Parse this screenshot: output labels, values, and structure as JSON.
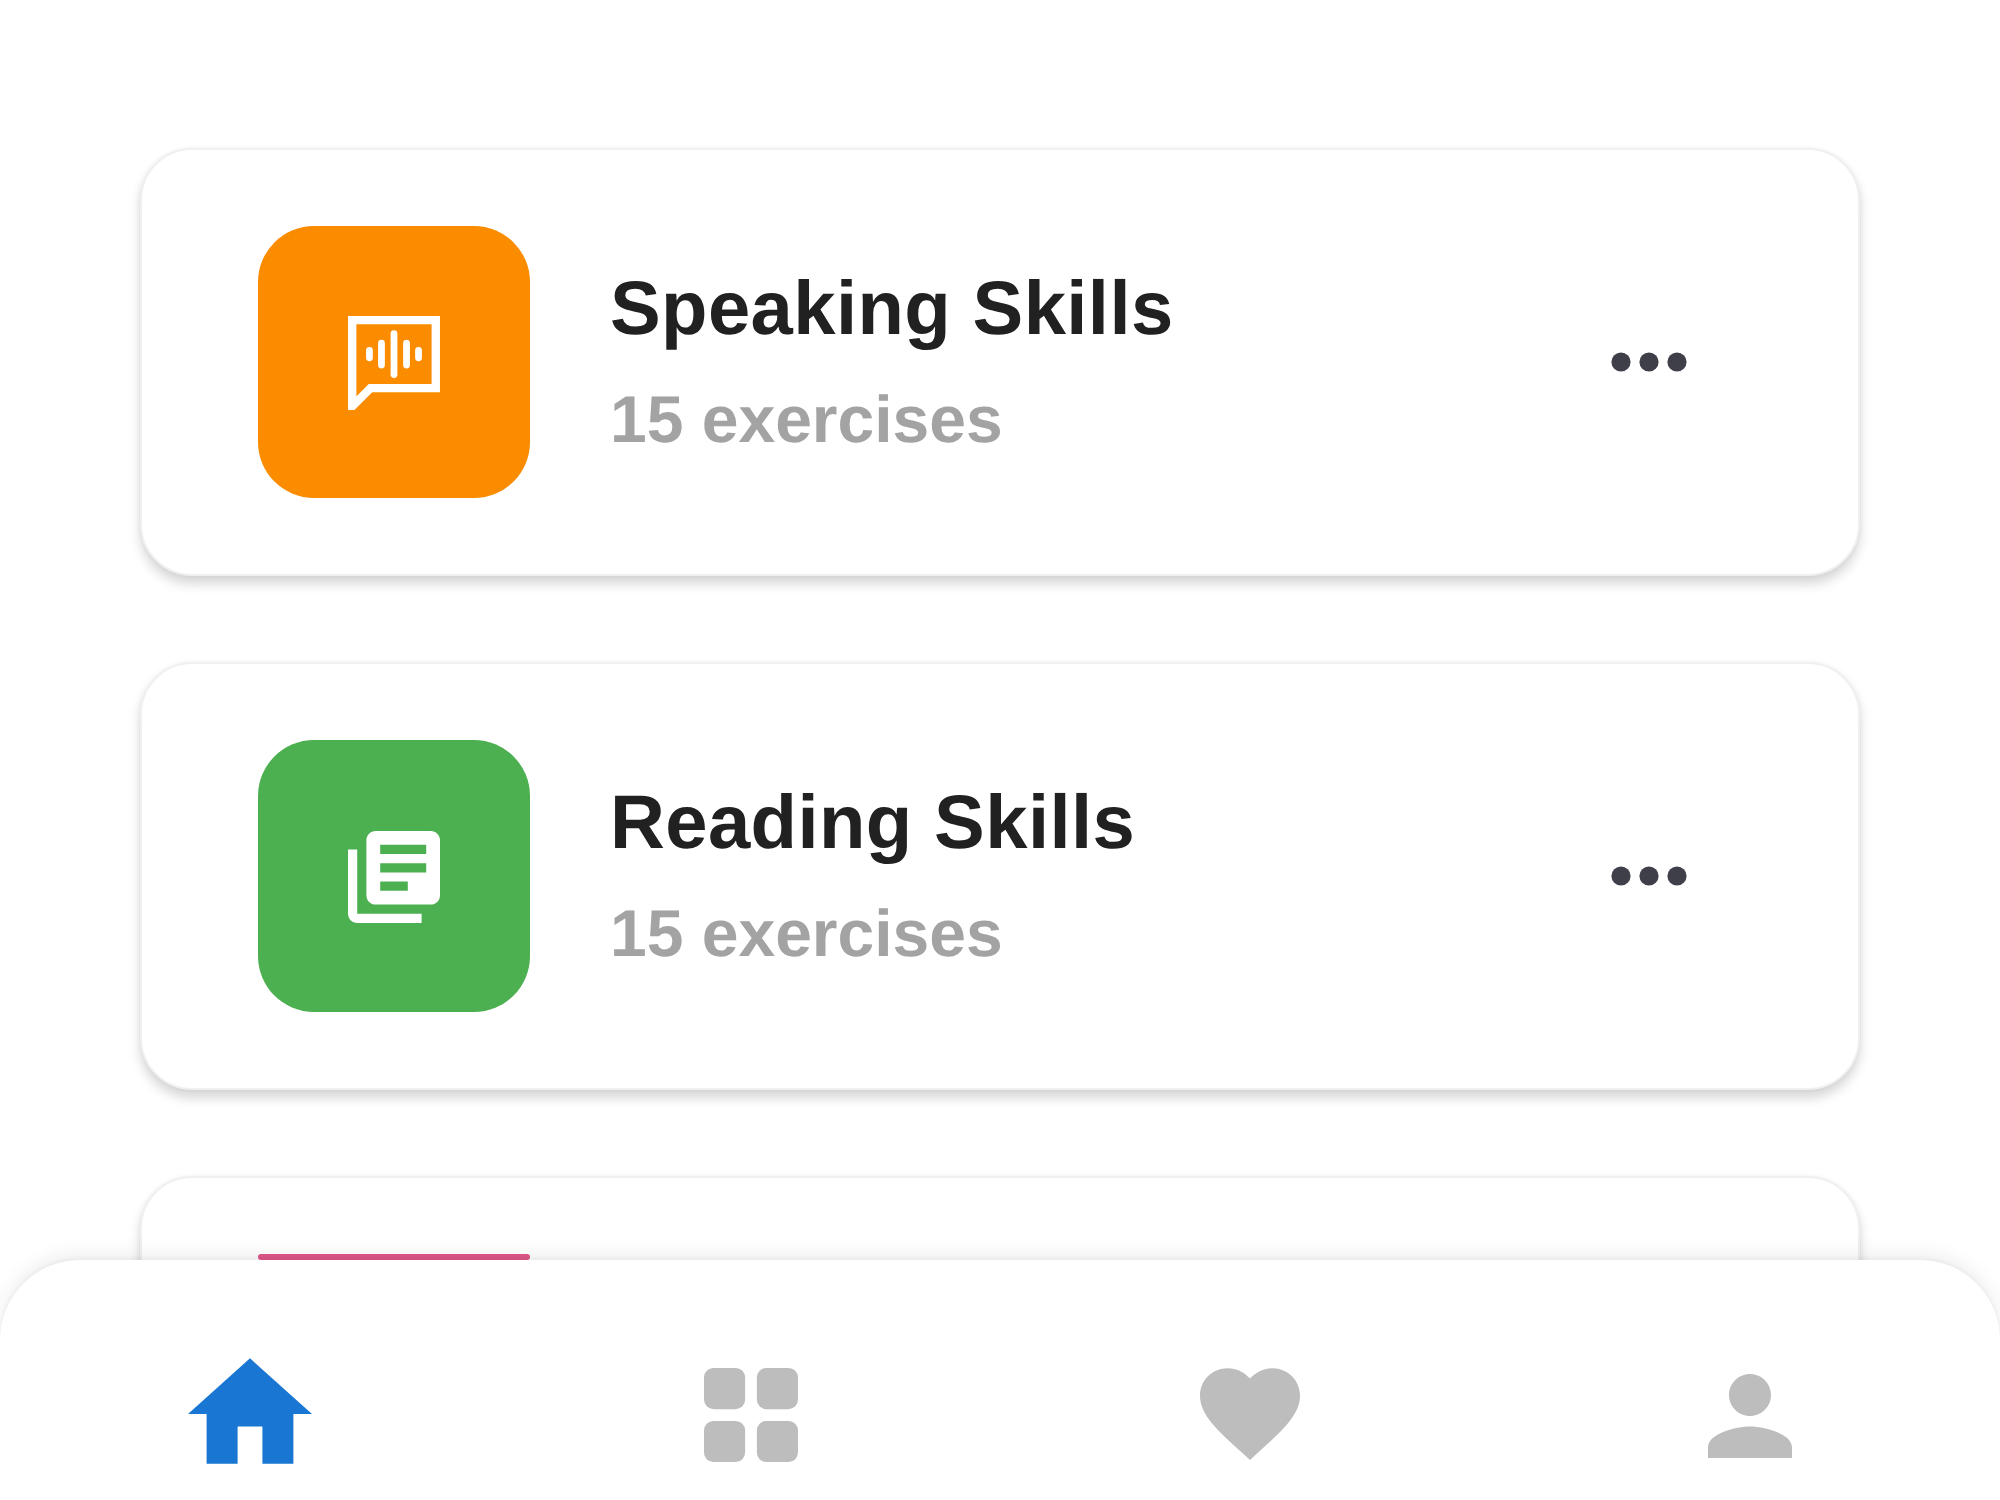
{
  "cards": [
    {
      "kind": "speaking",
      "color": "#fb8c00",
      "title": "Speaking Skills",
      "subtitle": "15 exercises"
    },
    {
      "kind": "reading",
      "color": "#4caf50",
      "title": "Reading Skills",
      "subtitle": "15 exercises"
    },
    {
      "color": "#e0588a"
    }
  ],
  "bottom_nav": {
    "items": [
      {
        "kind": "home",
        "selected": true
      },
      {
        "kind": "grid",
        "selected": false
      },
      {
        "kind": "heart",
        "selected": false
      },
      {
        "kind": "person",
        "selected": false
      }
    ]
  }
}
